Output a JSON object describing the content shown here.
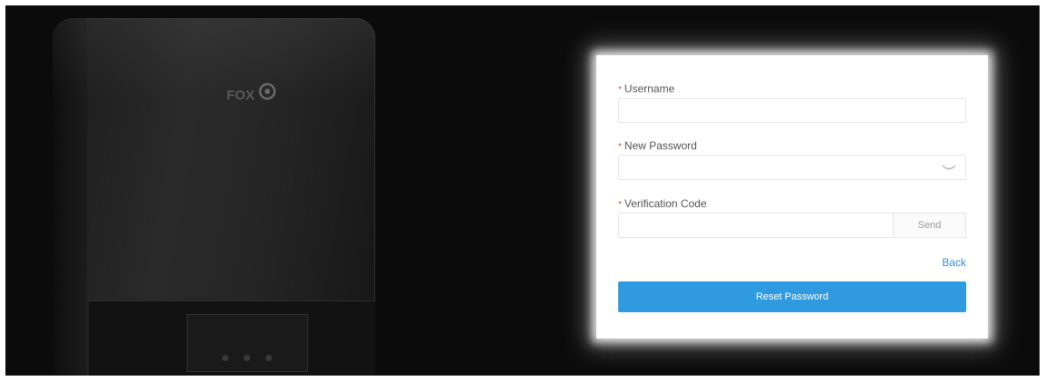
{
  "colors": {
    "background": "#0b0b0b",
    "accent": "#2f9ae0",
    "link": "#3a8fd6",
    "required_marker": "#e5484d"
  },
  "device": {
    "logo_icon": "fox-ess-logo"
  },
  "form": {
    "username": {
      "required_mark": "*",
      "label": "Username",
      "value": ""
    },
    "new_password": {
      "required_mark": "*",
      "label": "New Password",
      "value": "",
      "toggle_icon": "eye-closed-icon"
    },
    "verification_code": {
      "required_mark": "*",
      "label": "Verification Code",
      "value": "",
      "send_label": "Send"
    },
    "back_label": "Back",
    "reset_label": "Reset Password"
  }
}
